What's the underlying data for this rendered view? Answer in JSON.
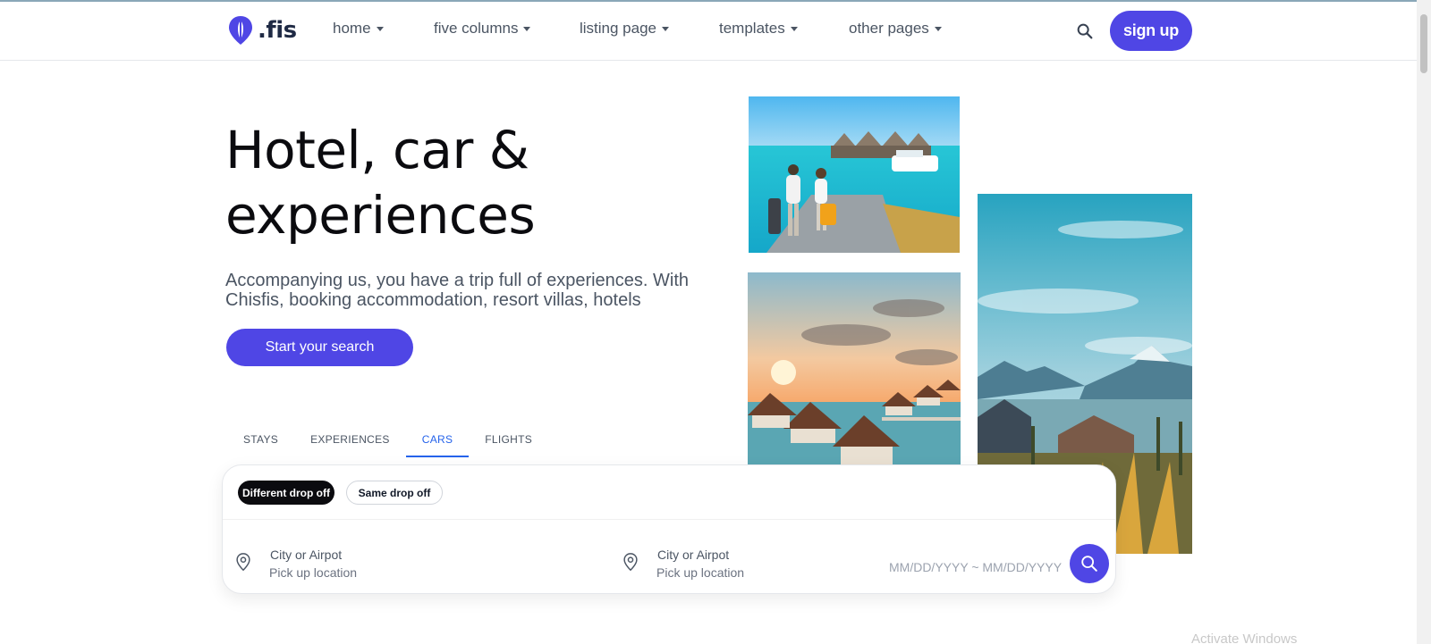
{
  "brand": {
    "name": ".fis",
    "accent": "#4f46e5"
  },
  "nav": {
    "items": [
      {
        "label": "home"
      },
      {
        "label": "five columns"
      },
      {
        "label": "listing page"
      },
      {
        "label": "templates"
      },
      {
        "label": "other pages"
      }
    ],
    "search_icon": "search-icon",
    "signup_label": "sign up"
  },
  "hero": {
    "title_line1": "Hotel, car &",
    "title_line2": "experiences",
    "description": "Accompanying us, you have a trip full of experiences. With Chisfis, booking accommodation, resort villas, hotels",
    "cta_label": "Start your search"
  },
  "tabs": [
    {
      "label": "STAYS",
      "active": false
    },
    {
      "label": "EXPERIENCES",
      "active": false
    },
    {
      "label": "CARS",
      "active": true
    },
    {
      "label": "FLIGHTS",
      "active": false
    }
  ],
  "search": {
    "dropoff_options": [
      {
        "label": "Different drop off",
        "selected": true
      },
      {
        "label": "Same drop off",
        "selected": false
      }
    ],
    "pickup": {
      "value": "City or Airpot",
      "placeholder": "Pick up location"
    },
    "dropoff": {
      "value": "City or Airpot",
      "placeholder": "Pick up location"
    },
    "date_range": "MM/DD/YYYY ~ MM/DD/YYYY"
  },
  "system": {
    "watermark": "Activate Windows"
  }
}
